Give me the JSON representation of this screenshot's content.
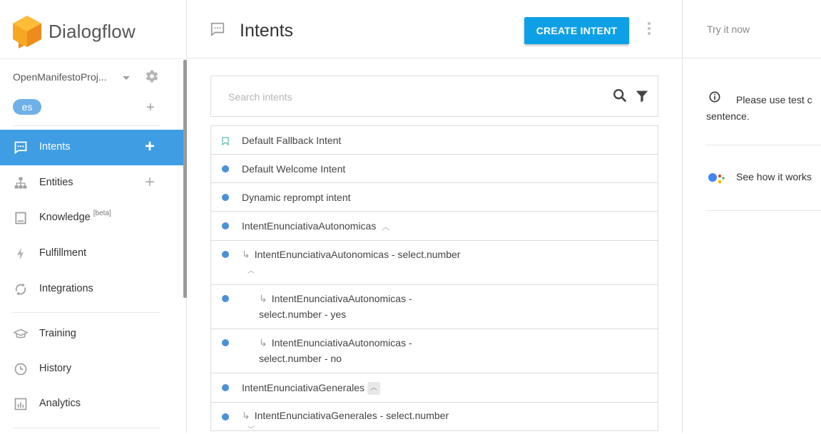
{
  "sidebar": {
    "brand": "Dialogflow",
    "agent_name": "OpenManifestoProj...",
    "language": "es",
    "nav": [
      {
        "label": "Intents",
        "icon": "intents-icon",
        "active": true,
        "has_add": true
      },
      {
        "label": "Entities",
        "icon": "entities-icon",
        "has_add": true
      },
      {
        "label": "Knowledge",
        "icon": "knowledge-icon",
        "badge": "[beta]"
      },
      {
        "label": "Fulfillment",
        "icon": "fulfillment-icon"
      },
      {
        "label": "Integrations",
        "icon": "integrations-icon"
      },
      {
        "label": "Training",
        "icon": "training-icon"
      },
      {
        "label": "History",
        "icon": "history-icon"
      },
      {
        "label": "Analytics",
        "icon": "analytics-icon"
      }
    ]
  },
  "main": {
    "title": "Intents",
    "create_button": "CREATE INTENT",
    "search_placeholder": "Search intents",
    "intents": [
      {
        "name": "Default Fallback Intent",
        "marker": "bookmark"
      },
      {
        "name": "Default Welcome Intent",
        "marker": "dot"
      },
      {
        "name": "Dynamic reprompt intent",
        "marker": "dot"
      },
      {
        "name": "IntentEnunciativaAutonomicas",
        "marker": "dot",
        "expanded": true
      },
      {
        "name": "IntentEnunciativaAutonomicas - select.number",
        "marker": "dot",
        "child_level": 1
      },
      {
        "name_line1": "IntentEnunciativaAutonomicas -",
        "name_line2": "select.number - yes",
        "marker": "dot",
        "child_level": 2
      },
      {
        "name_line1": "IntentEnunciativaAutonomicas -",
        "name_line2": "select.number - no",
        "marker": "dot",
        "child_level": 2
      },
      {
        "name": "IntentEnunciativaGenerales",
        "marker": "dot",
        "expanded": true
      },
      {
        "name": "IntentEnunciativaGenerales - select.number",
        "marker": "dot",
        "child_level": 1
      }
    ]
  },
  "right_panel": {
    "try_placeholder": "Try it now",
    "info_text": "Please use test c sentence.",
    "see_how": "See how it works"
  },
  "colors": {
    "accent": "#3f9de4",
    "button": "#0ea0e6",
    "dot": "#4a90d9",
    "logo": "#f59b1f"
  }
}
